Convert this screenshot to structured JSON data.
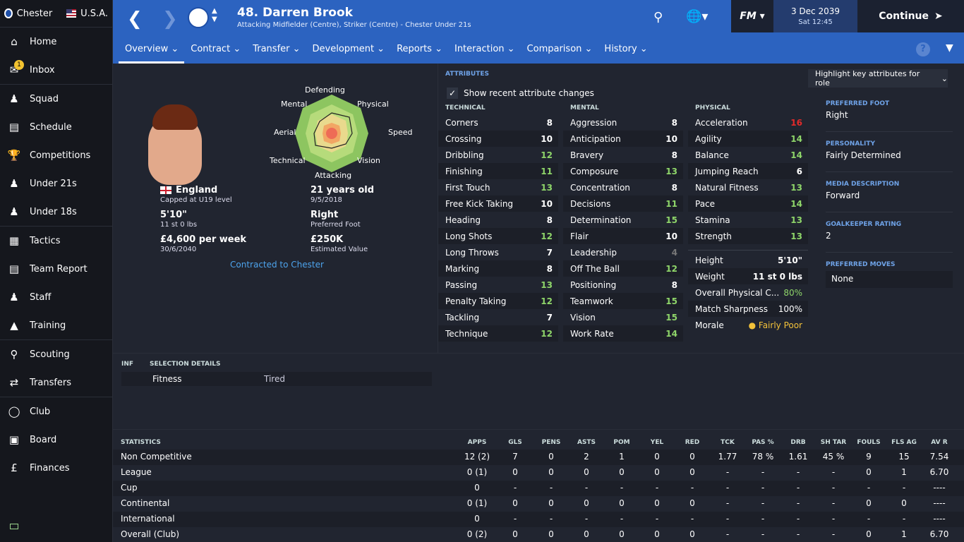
{
  "sidebar": {
    "club": "Chester",
    "nation": "U.S.A.",
    "inbox_badge": "1",
    "items": [
      {
        "label": "Home",
        "icon": "home-icon"
      },
      {
        "label": "Inbox",
        "icon": "inbox-icon"
      },
      {
        "label": "Squad",
        "icon": "squad-icon"
      },
      {
        "label": "Schedule",
        "icon": "calendar-icon"
      },
      {
        "label": "Competitions",
        "icon": "trophy-icon"
      },
      {
        "label": "Under 21s",
        "icon": "u21-icon"
      },
      {
        "label": "Under 18s",
        "icon": "u18-icon"
      },
      {
        "label": "Tactics",
        "icon": "tactics-icon"
      },
      {
        "label": "Team Report",
        "icon": "report-icon"
      },
      {
        "label": "Staff",
        "icon": "staff-icon"
      },
      {
        "label": "Training",
        "icon": "training-icon"
      },
      {
        "label": "Scouting",
        "icon": "search-icon"
      },
      {
        "label": "Transfers",
        "icon": "transfers-icon"
      },
      {
        "label": "Club",
        "icon": "shield-icon"
      },
      {
        "label": "Board",
        "icon": "briefcase-icon"
      },
      {
        "label": "Finances",
        "icon": "pound-icon"
      }
    ]
  },
  "header": {
    "title": "48. Darren Brook",
    "subtitle": "Attacking Midfielder (Centre), Striker (Centre) - Chester Under 21s",
    "fm": "FM",
    "date": "3 Dec 2039",
    "time": "Sat 12:45",
    "continue": "Continue",
    "tabs": [
      "Overview",
      "Contract",
      "Transfer",
      "Development",
      "Reports",
      "Interaction",
      "Comparison",
      "History"
    ]
  },
  "profile": {
    "nation": "England",
    "caps": "Capped at U19 level",
    "height": "5'10\"",
    "weight": "11 st 0 lbs",
    "wage": "£4,600 per week",
    "contract_end": "30/6/2040",
    "age": "21 years old",
    "dob": "9/5/2018",
    "foot": "Right",
    "foot_label": "Preferred Foot",
    "value": "£250K",
    "value_label": "Estimated Value",
    "contracted": "Contracted to Chester",
    "radar_labels": [
      "Defending",
      "Physical",
      "Speed",
      "Vision",
      "Attacking",
      "Technical",
      "Aerial",
      "Mental"
    ]
  },
  "attributes": {
    "title": "ATTRIBUTES",
    "highlight": "Highlight key attributes for role",
    "show_changes": "Show recent attribute changes",
    "technical_head": "TECHNICAL",
    "mental_head": "MENTAL",
    "physical_head": "PHYSICAL",
    "technical": [
      {
        "n": "Corners",
        "v": "8",
        "c": "v8"
      },
      {
        "n": "Crossing",
        "v": "10",
        "c": "v8"
      },
      {
        "n": "Dribbling",
        "v": "12",
        "c": "vg"
      },
      {
        "n": "Finishing",
        "v": "11",
        "c": "vg"
      },
      {
        "n": "First Touch",
        "v": "13",
        "c": "vg"
      },
      {
        "n": "Free Kick Taking",
        "v": "10",
        "c": "v8"
      },
      {
        "n": "Heading",
        "v": "8",
        "c": "v8"
      },
      {
        "n": "Long Shots",
        "v": "12",
        "c": "vg"
      },
      {
        "n": "Long Throws",
        "v": "7",
        "c": "v8"
      },
      {
        "n": "Marking",
        "v": "8",
        "c": "v8"
      },
      {
        "n": "Passing",
        "v": "13",
        "c": "vg"
      },
      {
        "n": "Penalty Taking",
        "v": "12",
        "c": "vg"
      },
      {
        "n": "Tackling",
        "v": "7",
        "c": "v8"
      },
      {
        "n": "Technique",
        "v": "12",
        "c": "vg"
      }
    ],
    "mental": [
      {
        "n": "Aggression",
        "v": "8",
        "c": "v8"
      },
      {
        "n": "Anticipation",
        "v": "10",
        "c": "v8"
      },
      {
        "n": "Bravery",
        "v": "8",
        "c": "v8"
      },
      {
        "n": "Composure",
        "v": "13",
        "c": "vg"
      },
      {
        "n": "Concentration",
        "v": "8",
        "c": "v8"
      },
      {
        "n": "Decisions",
        "v": "11",
        "c": "vg"
      },
      {
        "n": "Determination",
        "v": "15",
        "c": "vg"
      },
      {
        "n": "Flair",
        "v": "10",
        "c": "v8"
      },
      {
        "n": "Leadership",
        "v": "4",
        "c": "vd"
      },
      {
        "n": "Off The Ball",
        "v": "12",
        "c": "vg"
      },
      {
        "n": "Positioning",
        "v": "8",
        "c": "v8"
      },
      {
        "n": "Teamwork",
        "v": "15",
        "c": "vg"
      },
      {
        "n": "Vision",
        "v": "15",
        "c": "vg"
      },
      {
        "n": "Work Rate",
        "v": "14",
        "c": "vg"
      }
    ],
    "physical": [
      {
        "n": "Acceleration",
        "v": "16",
        "c": "vr"
      },
      {
        "n": "Agility",
        "v": "14",
        "c": "vg"
      },
      {
        "n": "Balance",
        "v": "14",
        "c": "vg"
      },
      {
        "n": "Jumping Reach",
        "v": "6",
        "c": "v8"
      },
      {
        "n": "Natural Fitness",
        "v": "13",
        "c": "vg"
      },
      {
        "n": "Pace",
        "v": "14",
        "c": "vg"
      },
      {
        "n": "Stamina",
        "v": "13",
        "c": "vg"
      },
      {
        "n": "Strength",
        "v": "13",
        "c": "vg"
      }
    ],
    "extra": [
      {
        "n": "Height",
        "v": "5'10\""
      },
      {
        "n": "Weight",
        "v": "11 st 0 lbs"
      },
      {
        "n": "Overall Physical C...",
        "v": "80%"
      },
      {
        "n": "Match Sharpness",
        "v": "100%"
      },
      {
        "n": "Morale",
        "v": "Fairly Poor"
      }
    ]
  },
  "side": {
    "foot_h": "PREFERRED FOOT",
    "foot_v": "Right",
    "pers_h": "PERSONALITY",
    "pers_v": "Fairly Determined",
    "media_h": "MEDIA DESCRIPTION",
    "media_v": "Forward",
    "gk_h": "GOALKEEPER RATING",
    "gk_v": "2",
    "moves_h": "PREFERRED MOVES",
    "moves_v": "None"
  },
  "selection": {
    "inf": "INF",
    "head": "SELECTION DETAILS",
    "label": "Fitness",
    "value": "Tired"
  },
  "statistics": {
    "title": "STATISTICS",
    "headers": [
      "APPS",
      "GLS",
      "PENS",
      "ASTS",
      "POM",
      "YEL",
      "RED",
      "TCK",
      "PAS %",
      "DRB",
      "SH TAR",
      "FOULS",
      "FLS AG",
      "AV R"
    ],
    "rows": [
      {
        "label": "Non Competitive",
        "cells": [
          "12 (2)",
          "7",
          "0",
          "2",
          "1",
          "0",
          "0",
          "1.77",
          "78 %",
          "1.61",
          "45 %",
          "9",
          "15",
          "7.54"
        ]
      },
      {
        "label": "League",
        "cells": [
          "0 (1)",
          "0",
          "0",
          "0",
          "0",
          "0",
          "0",
          "-",
          "-",
          "-",
          "-",
          "0",
          "1",
          "6.70"
        ]
      },
      {
        "label": "Cup",
        "cells": [
          "0",
          "-",
          "-",
          "-",
          "-",
          "-",
          "-",
          "-",
          "-",
          "-",
          "-",
          "-",
          "-",
          "----"
        ]
      },
      {
        "label": "Continental",
        "cells": [
          "0 (1)",
          "0",
          "0",
          "0",
          "0",
          "0",
          "0",
          "-",
          "-",
          "-",
          "-",
          "0",
          "0",
          "----"
        ]
      },
      {
        "label": "International",
        "cells": [
          "0",
          "-",
          "-",
          "-",
          "-",
          "-",
          "-",
          "-",
          "-",
          "-",
          "-",
          "-",
          "-",
          "----"
        ]
      },
      {
        "label": "Overall (Club)",
        "cells": [
          "0 (2)",
          "0",
          "0",
          "0",
          "0",
          "0",
          "0",
          "-",
          "-",
          "-",
          "-",
          "0",
          "1",
          "6.70"
        ]
      }
    ]
  }
}
